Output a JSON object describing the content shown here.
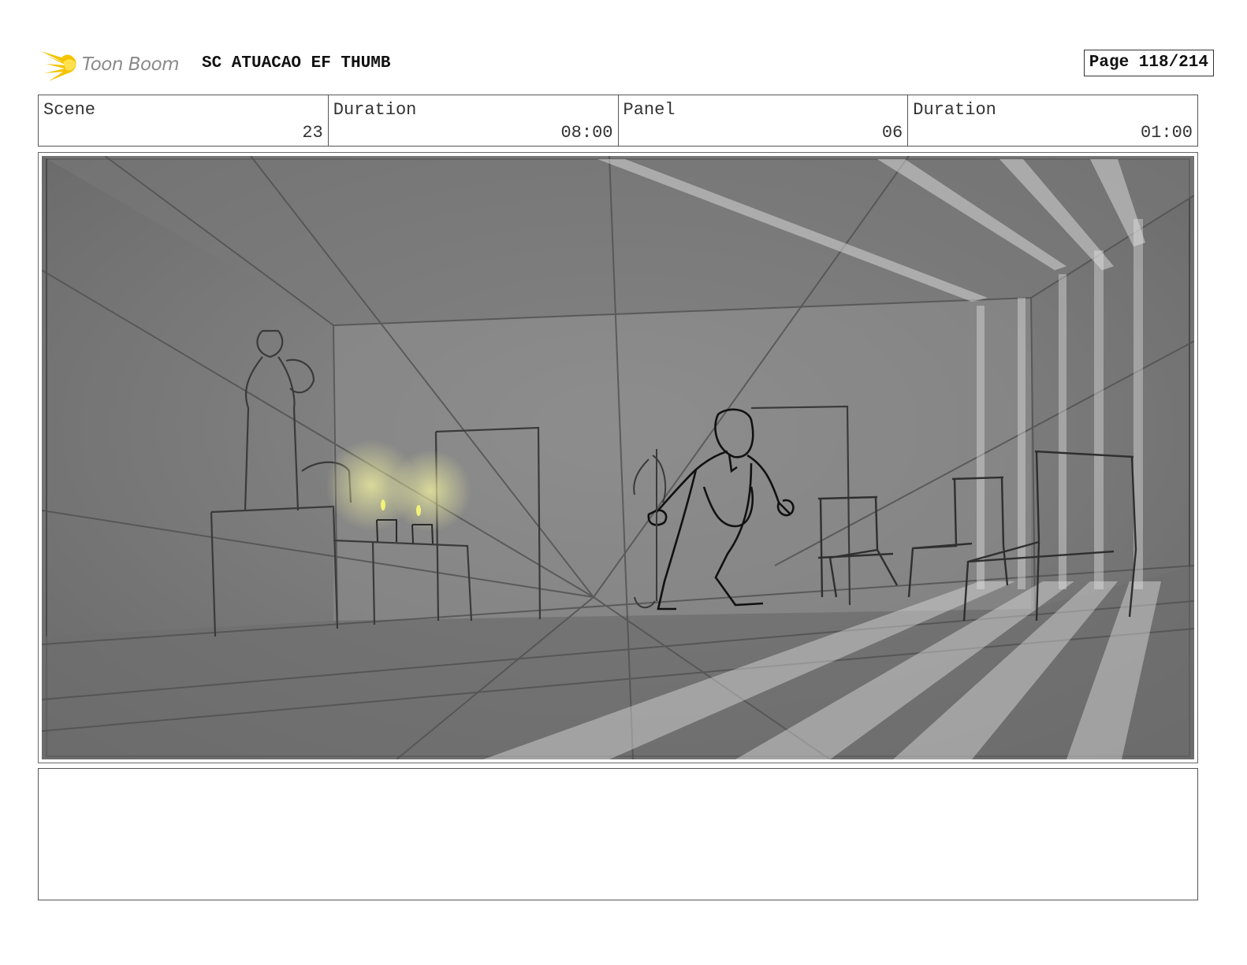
{
  "header": {
    "brand": "Toon Boom",
    "project_title": "SC ATUACAO EF THUMB",
    "page_label": "Page 118/214"
  },
  "info": {
    "scene_label": "Scene",
    "scene_value": "23",
    "scene_duration_label": "Duration",
    "scene_duration_value": "08:00",
    "panel_label": "Panel",
    "panel_value": "06",
    "panel_duration_label": "Duration",
    "panel_duration_value": "01:00"
  },
  "colors": {
    "logo_flame": "#f5c400",
    "candle_glow": "#f2f27a"
  },
  "notes": {
    "text": ""
  }
}
